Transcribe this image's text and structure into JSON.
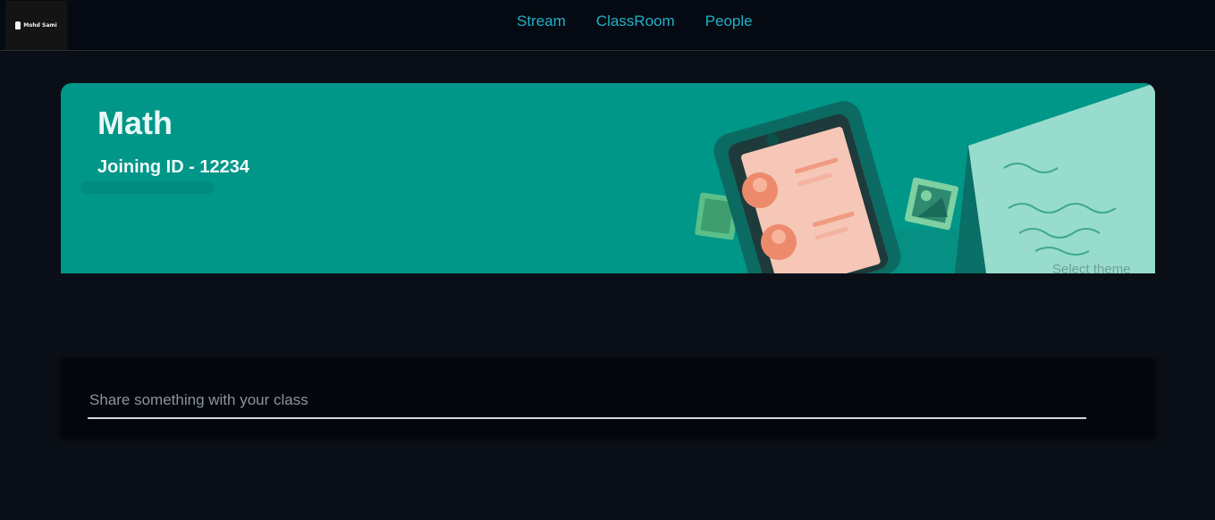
{
  "header": {
    "logo_text": "Mohd Sami",
    "nav": [
      "Stream",
      "ClassRoom",
      "People"
    ]
  },
  "banner": {
    "class_name": "Math",
    "joining_id": "Joining ID - 12234",
    "select_theme": "Select theme",
    "color": "#009688"
  },
  "post": {
    "placeholder": "Share something with your class"
  },
  "colors": {
    "background": "#0a0f17",
    "nav_link": "#22b0c8",
    "banner": "#009688"
  }
}
